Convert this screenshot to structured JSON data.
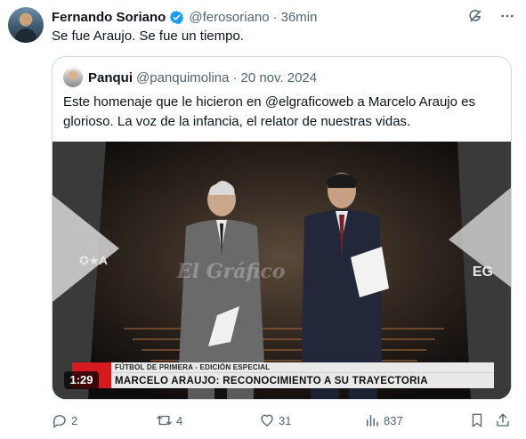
{
  "tweet": {
    "author_name": "Fernando Soriano",
    "handle": "@ferosoriano",
    "separator": "·",
    "time": "36min",
    "text": "Se fue Araujo. Se fue un tiempo."
  },
  "quote": {
    "author_name": "Panqui",
    "handle": "@panquimolina",
    "separator": "·",
    "date": "20 nov. 2024",
    "text": "Este homenaje que le hicieron en @elgraficoweb a Marcelo Araujo es glorioso. La voz de la infancia, el relator de nuestras vidas."
  },
  "video": {
    "duration": "1:29",
    "lower_third_top": "FÚTBOL DE PRIMERA - EDICIÓN ESPECIAL",
    "lower_third_main": "MARCELO ARAUJO: RECONOCIMIENTO A SU TRAYECTORIA",
    "logo_left": "✪★A",
    "logo_right": "EG",
    "watermark": "El Gráfico"
  },
  "actions": {
    "replies": "2",
    "reposts": "4",
    "likes": "31",
    "views": "837"
  },
  "icons": {
    "verified": "verified-badge-icon",
    "grok": "grok-icon",
    "more": "more-icon",
    "reply": "reply-icon",
    "repost": "repost-icon",
    "like": "like-icon",
    "views": "views-icon",
    "bookmark": "bookmark-icon",
    "share": "share-icon"
  },
  "colors": {
    "verified_blue": "#1d9bf0",
    "muted_text": "#536471",
    "border": "#cfd9de",
    "lower_third_red": "#d71920"
  }
}
